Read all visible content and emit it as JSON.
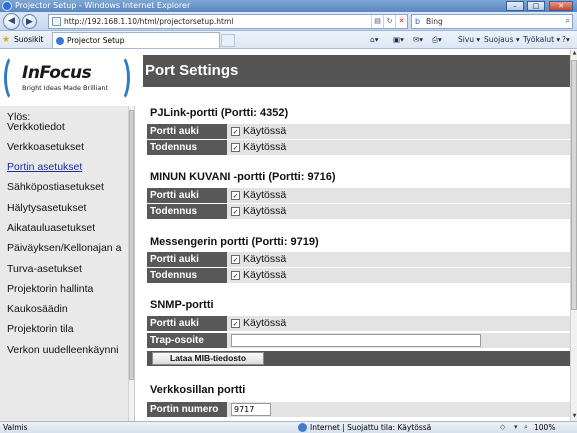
{
  "window": {
    "title": "Projector Setup - Windows Internet Explorer",
    "min": "–",
    "max": "□",
    "close": "✕"
  },
  "navbar": {
    "back": "◀",
    "forward": "▶",
    "address": "http://192.168.1.10/html/projectorsetup.html",
    "compat_icon": "▤",
    "refresh_icon": "↻",
    "stop_icon": "✕",
    "search_value": "Bing",
    "search_icon": "⌕"
  },
  "favbar": {
    "favorites": "Suosikit",
    "tab_title": "Projector Setup",
    "commands": {
      "page": "Sivu ▾",
      "safety": "Suojaus ▾",
      "tools": "Työkalut ▾",
      "help": "?▾",
      "home": "⌂▾",
      "feeds": "▣▾",
      "mail": "✉▾",
      "print": "⎙▾"
    }
  },
  "logo": {
    "brand": "InFocus",
    "tagline": "Bright Ideas Made Brilliant"
  },
  "menu": {
    "items": [
      {
        "label": "Ylös:"
      },
      {
        "label": "Verkkotiedot"
      },
      {
        "label": "Verkkoasetukset"
      },
      {
        "label": "Portin asetukset"
      },
      {
        "label": "Sähköpostiasetukset"
      },
      {
        "label": "Hälytysasetukset"
      },
      {
        "label": "Aikatauluasetukset"
      },
      {
        "label": "Päiväyksen/Kellonajan a"
      },
      {
        "label": "Turva-asetukset"
      },
      {
        "label": "Projektorin hallinta"
      },
      {
        "label": "Kaukosäädin"
      },
      {
        "label": "Projektorin tila"
      },
      {
        "label": "Verkon uudelleenkäynni"
      }
    ]
  },
  "content": {
    "header": "Port Settings",
    "check_mark": "✓",
    "sections": {
      "pjlink": {
        "title": "PJLink-portti (Portti: 4352)",
        "port_label": "Portti auki",
        "port_value": "Käytössä",
        "auth_label": "Todennus",
        "auth_value": "Käytössä"
      },
      "my_image": {
        "title": "MINUN KUVANI -portti (Portti: 9716)",
        "port_label": "Portti auki",
        "port_value": "Käytössä",
        "auth_label": "Todennus",
        "auth_value": "Käytössä"
      },
      "messenger": {
        "title": "Messengerin portti (Portti: 9719)",
        "port_label": "Portti auki",
        "port_value": "Käytössä",
        "auth_label": "Todennus",
        "auth_value": "Käytössä"
      },
      "snmp": {
        "title": "SNMP-portti",
        "port_label": "Portti auki",
        "port_value": "Käytössä",
        "trap_label": "Trap-osoite",
        "trap_value": "",
        "mib_button": "Lataa MIB-tiedosto"
      },
      "network_game": {
        "title": "Verkkosillan portti",
        "port_number_label": "Portin numero",
        "port_number_value": "9717"
      }
    }
  },
  "statusbar": {
    "left": "Valmis",
    "zone": "Internet | Suojattu tila: Käytössä",
    "zoom": "100%"
  }
}
